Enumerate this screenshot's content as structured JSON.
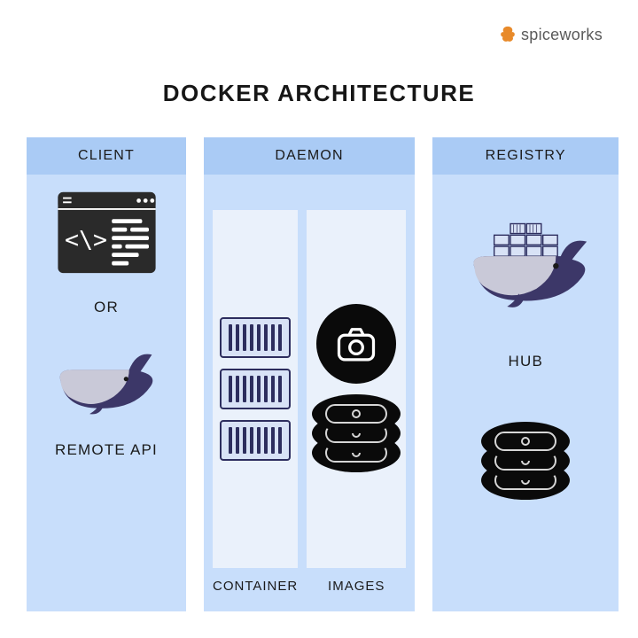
{
  "brand": {
    "text": "spiceworks"
  },
  "title": "DOCKER ARCHITECTURE",
  "columns": {
    "client": {
      "head": "CLIENT",
      "or_label": "OR",
      "api_label": "REMOTE  API"
    },
    "daemon": {
      "head": "DAEMON",
      "container_label": "CONTAINER",
      "images_label": "IMAGES"
    },
    "registry": {
      "head": "REGISTRY",
      "hub_label": "HUB"
    }
  }
}
